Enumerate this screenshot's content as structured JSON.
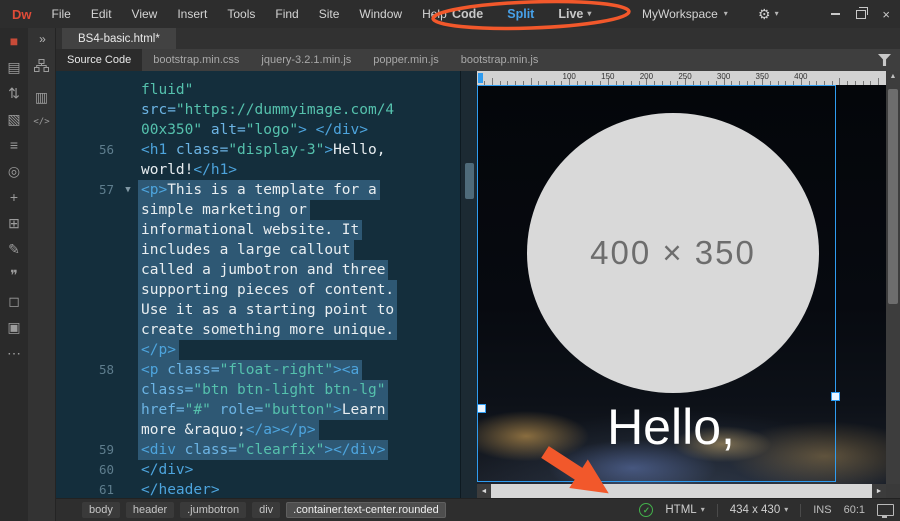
{
  "app": {
    "logo": "Dw",
    "menus": [
      "File",
      "Edit",
      "View",
      "Insert",
      "Tools",
      "Find",
      "Site",
      "Window",
      "Help"
    ],
    "workspace_label": "MyWorkspace"
  },
  "view_modes": [
    {
      "label": "Code",
      "active": false,
      "caret": false
    },
    {
      "label": "Split",
      "active": true,
      "caret": false
    },
    {
      "label": "Live",
      "active": false,
      "caret": true
    }
  ],
  "tabs": {
    "document_title": "BS4-basic.html*"
  },
  "related_files": [
    "Source Code",
    "bootstrap.min.css",
    "jquery-3.2.1.min.js",
    "popper.min.js",
    "bootstrap.min.js"
  ],
  "related_files_active": "Source Code",
  "left_toolbar_icons": [
    {
      "name": "insert-panel-icon",
      "glyph": "■",
      "color": "#c84b38"
    },
    {
      "name": "file-icon",
      "glyph": "▤"
    },
    {
      "name": "sort-icon",
      "glyph": "⇅"
    },
    {
      "name": "image-icon",
      "glyph": "▧"
    },
    {
      "name": "lines-icon",
      "glyph": "≡"
    },
    {
      "name": "target-icon",
      "glyph": "◎"
    },
    {
      "name": "move-icon",
      "glyph": "+"
    },
    {
      "name": "table-icon",
      "glyph": "⊞"
    },
    {
      "name": "pen-icon",
      "glyph": "✎"
    },
    {
      "name": "quote-icon",
      "glyph": "❞"
    },
    {
      "name": "comment-icon",
      "glyph": "◻"
    },
    {
      "name": "layers-icon",
      "glyph": "▣"
    },
    {
      "name": "more-icon",
      "glyph": "⋯"
    }
  ],
  "code_editor": {
    "rows": [
      {
        "num": "",
        "fold": false,
        "sel": false,
        "segs": [
          [
            "str",
            "fluid\""
          ]
        ]
      },
      {
        "num": "",
        "fold": false,
        "sel": false,
        "segs": [
          [
            "attr",
            "src="
          ],
          [
            "str",
            "\"https://dummyimage.com/4"
          ]
        ]
      },
      {
        "num": "",
        "fold": false,
        "sel": false,
        "segs": [
          [
            "str",
            "00x350\""
          ],
          [
            "attr",
            " alt="
          ],
          [
            "str",
            "\"logo\""
          ],
          [
            "tag",
            ">"
          ],
          [
            "txt",
            " "
          ],
          [
            "tag",
            "</div>"
          ]
        ]
      },
      {
        "num": "56",
        "fold": false,
        "sel": false,
        "segs": [
          [
            "tag",
            "<h1"
          ],
          [
            "attr",
            " class="
          ],
          [
            "str",
            "\"display-3\""
          ],
          [
            "tag",
            ">"
          ],
          [
            "txt",
            "Hello,"
          ]
        ]
      },
      {
        "num": "",
        "fold": false,
        "sel": false,
        "segs": [
          [
            "txt",
            "world!"
          ],
          [
            "tag",
            "</h1>"
          ]
        ]
      },
      {
        "num": "57",
        "fold": true,
        "sel": true,
        "segs": [
          [
            "tag",
            "<p>"
          ],
          [
            "txt",
            "This is a template for a"
          ]
        ]
      },
      {
        "num": "",
        "fold": false,
        "sel": true,
        "segs": [
          [
            "txt",
            "simple marketing or"
          ]
        ]
      },
      {
        "num": "",
        "fold": false,
        "sel": true,
        "segs": [
          [
            "txt",
            "informational website. It"
          ]
        ]
      },
      {
        "num": "",
        "fold": false,
        "sel": true,
        "segs": [
          [
            "txt",
            "includes a large callout"
          ]
        ]
      },
      {
        "num": "",
        "fold": false,
        "sel": true,
        "segs": [
          [
            "txt",
            "called a jumbotron and three"
          ]
        ]
      },
      {
        "num": "",
        "fold": false,
        "sel": true,
        "segs": [
          [
            "txt",
            "supporting pieces of content."
          ]
        ]
      },
      {
        "num": "",
        "fold": false,
        "sel": true,
        "segs": [
          [
            "txt",
            "Use it as a starting point to"
          ]
        ]
      },
      {
        "num": "",
        "fold": false,
        "sel": true,
        "segs": [
          [
            "txt",
            "create something more unique."
          ]
        ]
      },
      {
        "num": "",
        "fold": false,
        "sel": true,
        "segs": [
          [
            "tag",
            "</p>"
          ]
        ]
      },
      {
        "num": "58",
        "fold": false,
        "sel": true,
        "segs": [
          [
            "tag",
            "<p"
          ],
          [
            "attr",
            " class="
          ],
          [
            "str",
            "\"float-right\""
          ],
          [
            "tag",
            "><a"
          ]
        ]
      },
      {
        "num": "",
        "fold": false,
        "sel": true,
        "segs": [
          [
            "attr",
            "class="
          ],
          [
            "str",
            "\"btn btn-light btn-lg\""
          ]
        ]
      },
      {
        "num": "",
        "fold": false,
        "sel": true,
        "segs": [
          [
            "attr",
            "href="
          ],
          [
            "str",
            "\"#\""
          ],
          [
            "attr",
            " role="
          ],
          [
            "str",
            "\"button\""
          ],
          [
            "tag",
            ">"
          ],
          [
            "txt",
            "Learn"
          ]
        ]
      },
      {
        "num": "",
        "fold": false,
        "sel": true,
        "segs": [
          [
            "txt",
            "more "
          ],
          [
            "ent",
            "&raquo;"
          ],
          [
            "tag",
            "</a></p>"
          ]
        ]
      },
      {
        "num": "59",
        "fold": false,
        "sel": true,
        "segs": [
          [
            "tag",
            "<div"
          ],
          [
            "attr",
            " class="
          ],
          [
            "str",
            "\"clearfix\""
          ],
          [
            "tag",
            "></div>"
          ]
        ]
      },
      {
        "num": "60",
        "fold": false,
        "sel": false,
        "segs": [
          [
            "tag",
            "</div>"
          ]
        ]
      },
      {
        "num": "61",
        "fold": false,
        "sel": false,
        "segs": [
          [
            "tag",
            "</header>"
          ]
        ]
      }
    ]
  },
  "live_view": {
    "ruler_labels": [
      100,
      150,
      200,
      250,
      300,
      350,
      400
    ],
    "placeholder_text": "400 × 350",
    "hello_text": "Hello,"
  },
  "status_bar": {
    "tag_path": [
      {
        "label": "body",
        "selected": false
      },
      {
        "label": "header",
        "selected": false
      },
      {
        "label": ".jumbotron",
        "selected": false
      },
      {
        "label": "div",
        "selected": false
      },
      {
        "label": ".container.text-center.rounded",
        "selected": true
      }
    ],
    "doc_type": "HTML",
    "dimensions": "434 x 430",
    "ins_label": "INS",
    "cursor_position": "60:1"
  },
  "icons": {
    "caret_down": "▾",
    "fold": "▼",
    "check": "✓",
    "close": "×",
    "chevrons": "»",
    "pages": "▥",
    "code_tag": "</>",
    "gear": "⚙",
    "up_arrow": "▲",
    "left_arrow": "◄",
    "right_arrow": "►"
  },
  "colors": {
    "brand_red": "#df4b38",
    "accent_blue": "#47a1e9",
    "selection_blue": "#2f9cf0",
    "annotation_orange": "#f2582b",
    "check_green": "#43b14b"
  }
}
